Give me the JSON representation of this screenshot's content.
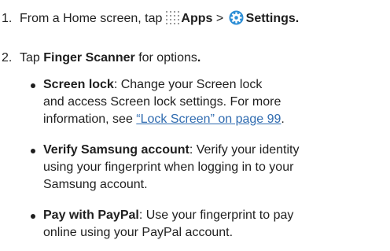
{
  "steps": [
    {
      "number": "1.",
      "text_before": "From a Home screen, tap",
      "apps_label": "Apps",
      "separator": ">",
      "settings_label": "Settings",
      "end": "."
    },
    {
      "number": "2.",
      "text_before": "Tap",
      "bold": "Finger Scanner",
      "text_after": "for options",
      "end": "."
    }
  ],
  "bullets": [
    {
      "term": "Screen lock",
      "lines": [
        ": Change your Screen lock",
        "and access Screen lock settings. For more",
        "information, see"
      ],
      "link": "“Lock Screen” on page 99",
      "link_end": "."
    },
    {
      "term": "Verify Samsung account",
      "lines": [
        ": Verify your identity",
        "using your fingerprint when logging in to your",
        "Samsung account."
      ]
    },
    {
      "term": "Pay with PayPal",
      "lines": [
        ": Use your fingerprint to pay",
        "online using your PayPal account."
      ]
    }
  ],
  "icons": {
    "apps": "apps-grid-icon",
    "settings": "gear-icon"
  }
}
